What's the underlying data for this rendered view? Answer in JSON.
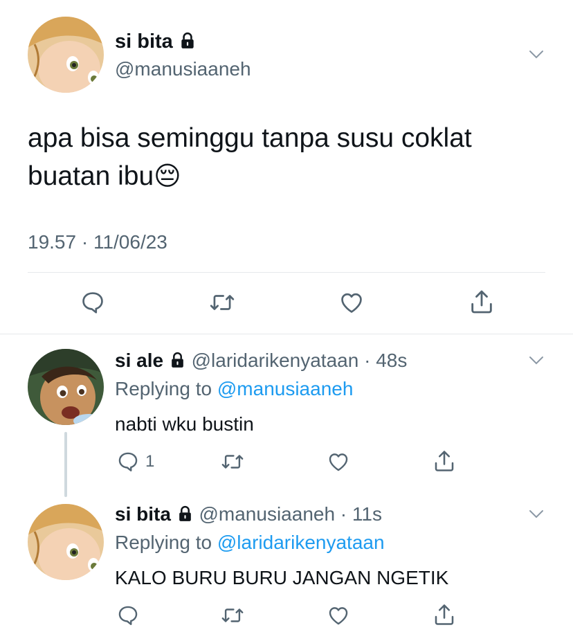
{
  "main_tweet": {
    "display_name": "si bita",
    "handle": "@manusiaaneh",
    "text": "apa bisa seminggu tanpa susu coklat buatan ibu😔",
    "text_line1": "apa bisa seminggu tanpa susu coklat",
    "text_line2": "buatan ibu",
    "emoji": "😔",
    "timestamp": "19.57 · 11/06/23",
    "icons": [
      "reply-icon",
      "retweet-icon",
      "like-icon",
      "share-icon"
    ]
  },
  "replies": [
    {
      "display_name": "si ale",
      "handle": "@laridarikenyataan",
      "time": "48s",
      "replying_prefix": "Replying to",
      "replying_to": "@manusiaaneh",
      "text": "nabti wku bustin",
      "reply_count": "1"
    },
    {
      "display_name": "si bita",
      "handle": "@manusiaaneh",
      "time": "11s",
      "replying_prefix": "Replying to",
      "replying_to": "@laridarikenyataan",
      "text": "KALO BURU BURU JANGAN NGETIK",
      "reply_count": ""
    }
  ],
  "colors": {
    "accent": "#1d9bf0",
    "muted": "#536471",
    "text": "#0f1419",
    "divider": "#e6e9eb"
  }
}
